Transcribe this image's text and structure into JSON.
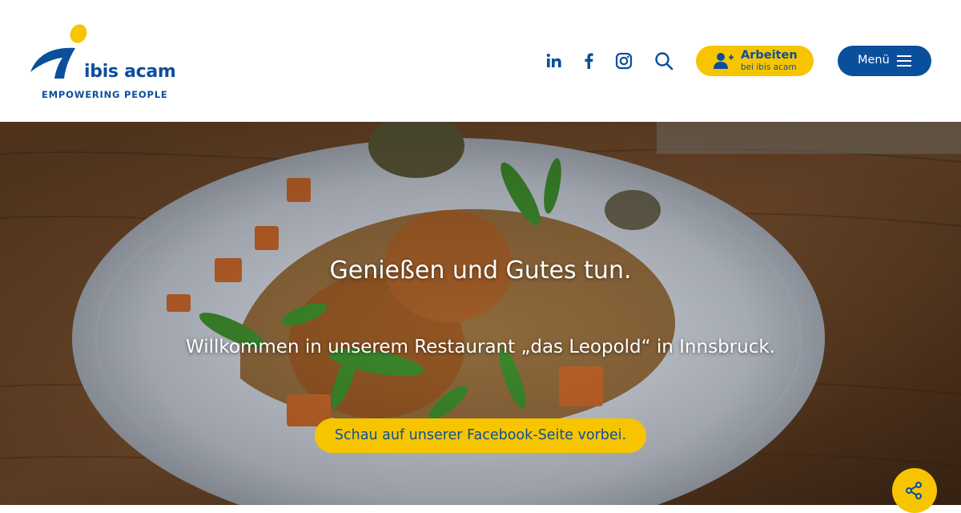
{
  "brand": {
    "name": "ibis acam",
    "tagline": "EMPOWERING PEOPLE"
  },
  "header": {
    "social": [
      {
        "icon": "linkedin-icon",
        "label": "in"
      },
      {
        "icon": "facebook-icon",
        "label": "f"
      },
      {
        "icon": "instagram-icon"
      }
    ],
    "search_icon": "search-icon",
    "jobs_button": {
      "label": "Arbeiten",
      "sublabel": "bei ibis acam",
      "icon": "user-plus-icon"
    },
    "menu_button": {
      "label": "Menü",
      "icon": "hamburger-icon"
    }
  },
  "hero": {
    "title": "Genießen und Gutes tun.",
    "subtitle": "Willkommen in unserem Restaurant „das Leopold“ in Innsbruck.",
    "cta": "Schau auf unserer Facebook-Seite vorbei."
  },
  "share_button": {
    "icon": "share-icon"
  },
  "colors": {
    "primary_blue": "#0a4f9c",
    "accent_yellow": "#f6c500"
  }
}
